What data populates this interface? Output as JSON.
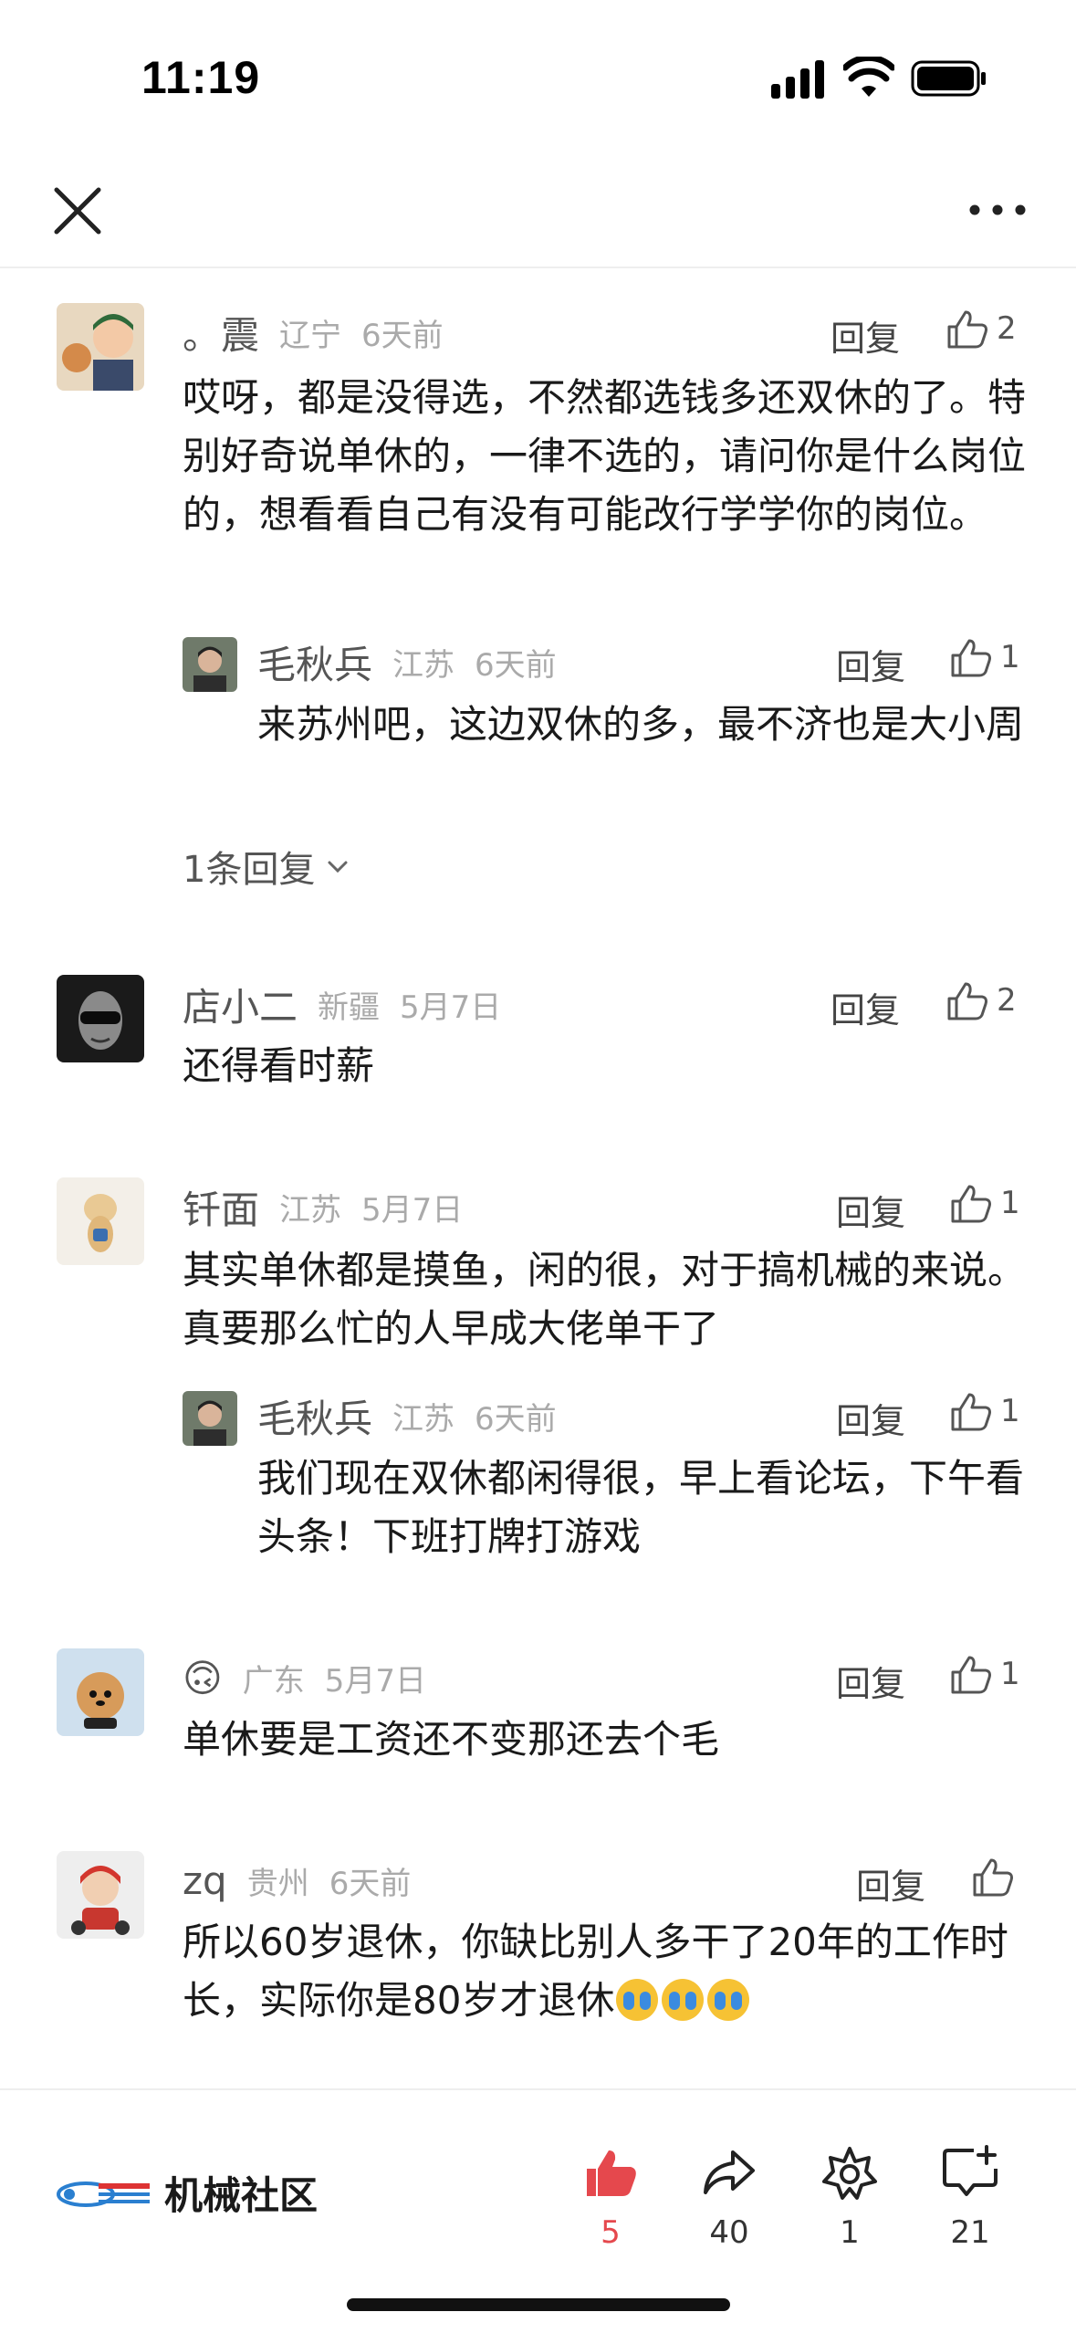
{
  "status_bar": {
    "time": "11:19"
  },
  "comments": [
    {
      "name": "。震",
      "location": "辽宁",
      "time": "6天前",
      "likes": "2",
      "reply_label": "回复",
      "text": "哎呀，都是没得选，不然都选钱多还双休的了。特别好奇说单休的，一律不选的，请问你是什么岗位的，想看看自己有没有可能改行学学你的岗位。",
      "replies": [
        {
          "name": "毛秋兵",
          "location": "江苏",
          "time": "6天前",
          "likes": "1",
          "reply_label": "回复",
          "text": "来苏州吧，这边双休的多，最不济也是大小周"
        }
      ],
      "replies_toggle": "1条回复"
    },
    {
      "name": "店小二",
      "location": "新疆",
      "time": "5月7日",
      "likes": "2",
      "reply_label": "回复",
      "text": "还得看时薪"
    },
    {
      "name": "钎面",
      "location": "江苏",
      "time": "5月7日",
      "likes": "1",
      "reply_label": "回复",
      "text": "其实单休都是摸鱼，闲的很，对于搞机械的来说。真要那么忙的人早成大佬单干了",
      "replies": [
        {
          "name": "毛秋兵",
          "location": "江苏",
          "time": "6天前",
          "likes": "1",
          "reply_label": "回复",
          "text": "我们现在双休都闲得很，早上看论坛，下午看头条！下班打牌打游戏"
        }
      ]
    },
    {
      "name": "🙃",
      "location": "广东",
      "time": "5月7日",
      "likes": "1",
      "reply_label": "回复",
      "text": "单休要是工资还不变那还去个毛"
    },
    {
      "name": "zq",
      "location": "贵州",
      "time": "6天前",
      "likes": "",
      "reply_label": "回复",
      "text": "所以60岁退休，你缺比别人多干了20年的工作时长，实际你是80岁才退休",
      "text_emojis": [
        "😭",
        "😭",
        "😭"
      ]
    }
  ],
  "bottom_bar": {
    "brand_name": "机械社区",
    "like_count": "5",
    "share_count": "40",
    "favorite_count": "1",
    "comment_count": "21"
  },
  "colors": {
    "accent": "#e5484d",
    "secondary_text": "#aaaaaa"
  },
  "icons": {
    "close": "close-icon",
    "more": "more-icon",
    "like": "thumbs-up-icon",
    "share": "share-icon",
    "favorite": "star-icon",
    "comment": "comment-add-icon"
  }
}
